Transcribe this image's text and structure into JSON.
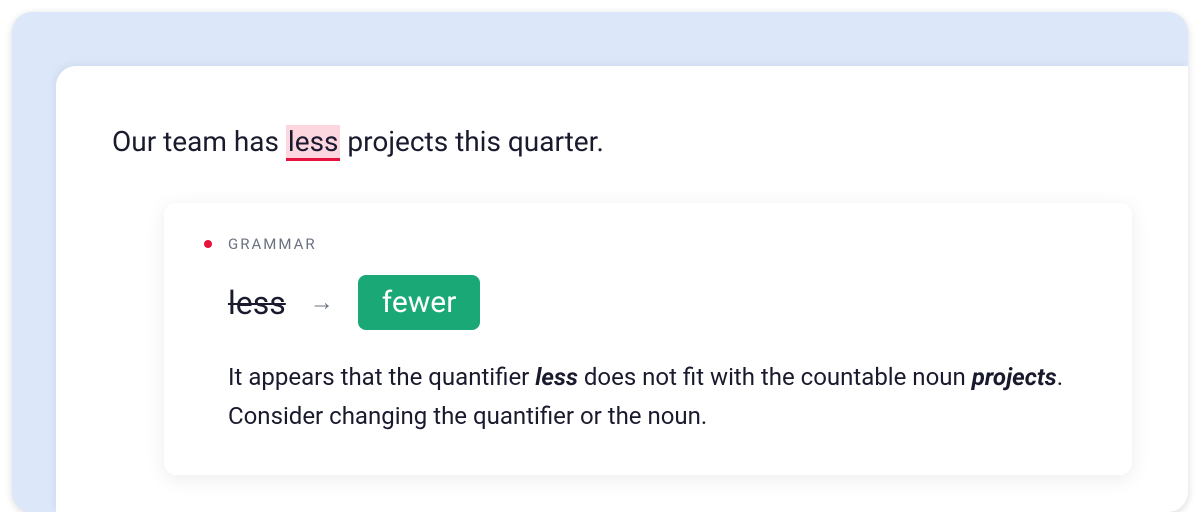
{
  "sentence": {
    "before": "Our team has ",
    "highlighted": "less",
    "after": " projects this quarter."
  },
  "card": {
    "category": "GRAMMAR",
    "struck": "less",
    "arrow": "→",
    "replacement": "fewer",
    "explanation_parts": {
      "t1": "It appears that the quantifier ",
      "em1": "less",
      "t2": " does not fit with the countable noun ",
      "em2": "projects",
      "t3": ". Consider changing the quantifier or the noun."
    }
  },
  "colors": {
    "highlight_bg": "#fdd7df",
    "underline": "#e6123d",
    "dot": "#e6123d",
    "replacement_bg": "#1aa877"
  }
}
